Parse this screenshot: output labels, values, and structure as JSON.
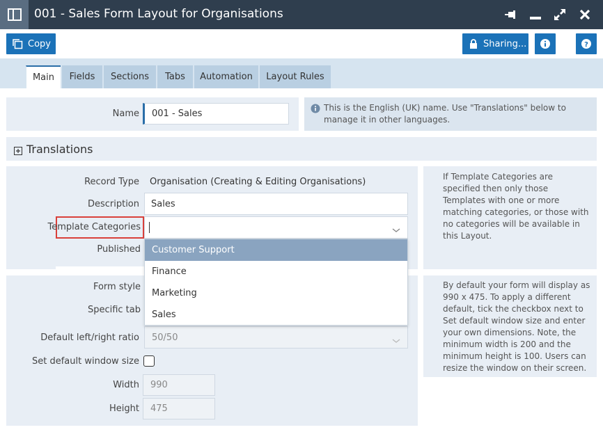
{
  "window": {
    "title": "001 - Sales Form Layout for Organisations",
    "icons": [
      "layout-icon",
      "pin-icon",
      "minimize-icon",
      "expand-icon",
      "close-icon"
    ]
  },
  "toolbar": {
    "copy_label": "Copy",
    "sharing_label": "Sharing...",
    "info_icon": "info-icon",
    "help_icon": "help-icon"
  },
  "tabs": [
    {
      "label": "Main",
      "active": true
    },
    {
      "label": "Fields",
      "active": false
    },
    {
      "label": "Sections",
      "active": false
    },
    {
      "label": "Tabs",
      "active": false
    },
    {
      "label": "Automation",
      "active": false
    },
    {
      "label": "Layout Rules",
      "active": false
    }
  ],
  "name_section": {
    "label": "Name",
    "value": "001 - Sales",
    "info": "This is the English (UK) name. Use \"Translations\" below to manage it in other languages."
  },
  "translations": {
    "label": "Translations"
  },
  "record_section": {
    "record_type_label": "Record Type",
    "record_type_value": "Organisation (Creating & Editing Organisations)",
    "description_label": "Description",
    "description_value": "Sales",
    "template_categories_label": "Template Categories",
    "template_categories_value": "",
    "published_label": "Published",
    "info": "If Template Categories are specified then only those Templates with one or more matching categories, or those with no categories will be available in this Layout."
  },
  "dropdown": {
    "options": [
      "Customer Support",
      "Finance",
      "Marketing",
      "Sales"
    ],
    "highlighted": "Customer Support"
  },
  "form_section": {
    "form_style_label": "Form style",
    "specific_tab_label": "Specific tab",
    "ratio_label": "Default left/right ratio",
    "ratio_value": "50/50",
    "window_size_label": "Set default window size",
    "window_size_checked": false,
    "width_label": "Width",
    "width_value": "990",
    "height_label": "Height",
    "height_value": "475",
    "info": "By default your form will display as 990 x 475. To apply a different default, tick the checkbox next to Set default window size and enter your own dimensions. Note, the minimum width is 200 and the minimum height is 100. Users can resize the window on their screen."
  },
  "colors": {
    "titlebar": "#2f3e4e",
    "accent": "#1b72b8",
    "panel": "#e8eef5",
    "highlight_border": "#d9403a",
    "dropdown_selected": "#8aa4c0"
  }
}
